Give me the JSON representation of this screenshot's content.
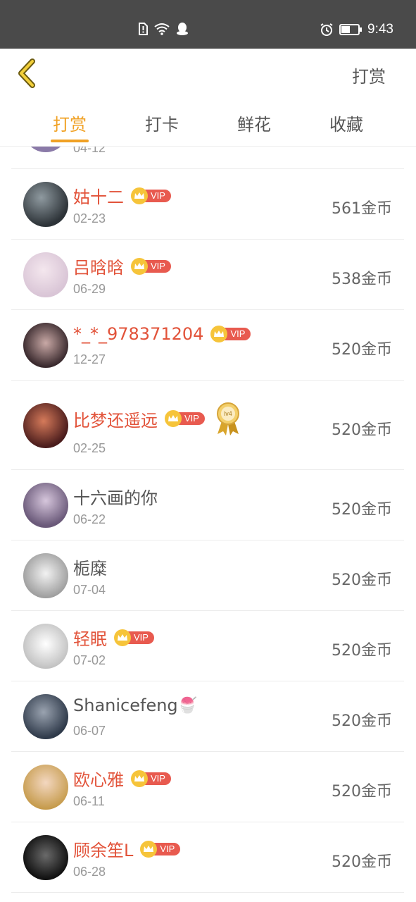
{
  "status_bar": {
    "time": "9:43"
  },
  "header": {
    "back_icon": "chevron-left-icon",
    "action_label": "打赏"
  },
  "tabs": [
    {
      "label": "打赏",
      "active": true
    },
    {
      "label": "打卡",
      "active": false
    },
    {
      "label": "鲜花",
      "active": false
    },
    {
      "label": "收藏",
      "active": false
    }
  ],
  "colors": {
    "accent": "#f0a124",
    "vip_name": "#e2533a",
    "vip_tag": "#e85a4f",
    "crown": "#f6c43a"
  },
  "vip_label": "VIP",
  "medal_label": "lv4",
  "partial_row": {
    "date": "04-12"
  },
  "list": [
    {
      "name": "姑十二",
      "vip": true,
      "date": "02-23",
      "amount": "561金币"
    },
    {
      "name": "吕晗晗",
      "vip": true,
      "date": "06-29",
      "amount": "538金币"
    },
    {
      "name": "*_*_978371204",
      "vip": true,
      "date": "12-27",
      "amount": "520金币"
    },
    {
      "name": "比梦还遥远",
      "vip": true,
      "medal": true,
      "date": "02-25",
      "amount": "520金币"
    },
    {
      "name": "十六画的你",
      "vip": false,
      "date": "06-22",
      "amount": "520金币"
    },
    {
      "name": "栀糜",
      "vip": false,
      "date": "07-04",
      "amount": "520金币"
    },
    {
      "name": "轻眠",
      "vip": true,
      "date": "07-02",
      "amount": "520金币"
    },
    {
      "name": "Shanicefeng",
      "vip": false,
      "emoji": "🍧",
      "date": "06-07",
      "amount": "520金币"
    },
    {
      "name": "欧心雅",
      "vip": true,
      "date": "06-11",
      "amount": "520金币"
    },
    {
      "name": "顾余笙L",
      "vip": true,
      "date": "06-28",
      "amount": "520金币"
    }
  ]
}
